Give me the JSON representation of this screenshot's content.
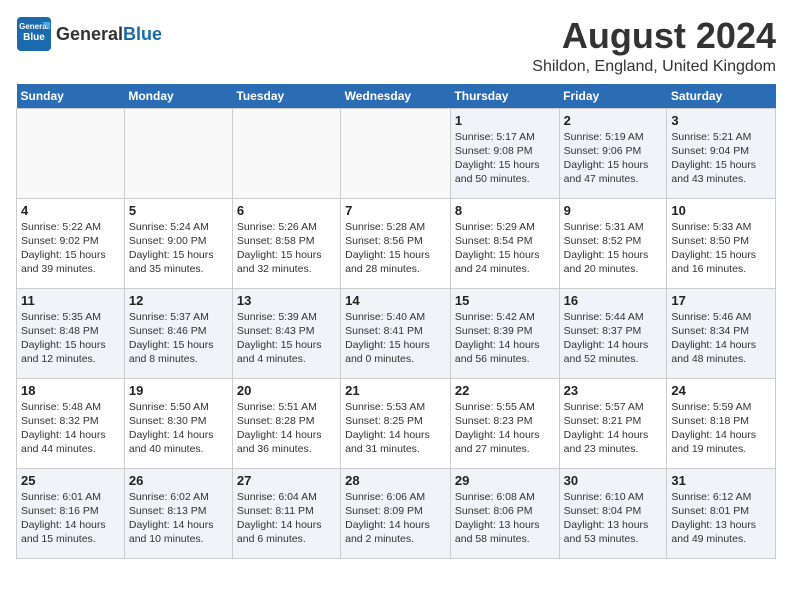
{
  "header": {
    "logo_general": "General",
    "logo_blue": "Blue",
    "month_year": "August 2024",
    "location": "Shildon, England, United Kingdom"
  },
  "weekdays": [
    "Sunday",
    "Monday",
    "Tuesday",
    "Wednesday",
    "Thursday",
    "Friday",
    "Saturday"
  ],
  "weeks": [
    [
      {
        "day": "",
        "info": ""
      },
      {
        "day": "",
        "info": ""
      },
      {
        "day": "",
        "info": ""
      },
      {
        "day": "",
        "info": ""
      },
      {
        "day": "1",
        "info": "Sunrise: 5:17 AM\nSunset: 9:08 PM\nDaylight: 15 hours\nand 50 minutes."
      },
      {
        "day": "2",
        "info": "Sunrise: 5:19 AM\nSunset: 9:06 PM\nDaylight: 15 hours\nand 47 minutes."
      },
      {
        "day": "3",
        "info": "Sunrise: 5:21 AM\nSunset: 9:04 PM\nDaylight: 15 hours\nand 43 minutes."
      }
    ],
    [
      {
        "day": "4",
        "info": "Sunrise: 5:22 AM\nSunset: 9:02 PM\nDaylight: 15 hours\nand 39 minutes."
      },
      {
        "day": "5",
        "info": "Sunrise: 5:24 AM\nSunset: 9:00 PM\nDaylight: 15 hours\nand 35 minutes."
      },
      {
        "day": "6",
        "info": "Sunrise: 5:26 AM\nSunset: 8:58 PM\nDaylight: 15 hours\nand 32 minutes."
      },
      {
        "day": "7",
        "info": "Sunrise: 5:28 AM\nSunset: 8:56 PM\nDaylight: 15 hours\nand 28 minutes."
      },
      {
        "day": "8",
        "info": "Sunrise: 5:29 AM\nSunset: 8:54 PM\nDaylight: 15 hours\nand 24 minutes."
      },
      {
        "day": "9",
        "info": "Sunrise: 5:31 AM\nSunset: 8:52 PM\nDaylight: 15 hours\nand 20 minutes."
      },
      {
        "day": "10",
        "info": "Sunrise: 5:33 AM\nSunset: 8:50 PM\nDaylight: 15 hours\nand 16 minutes."
      }
    ],
    [
      {
        "day": "11",
        "info": "Sunrise: 5:35 AM\nSunset: 8:48 PM\nDaylight: 15 hours\nand 12 minutes."
      },
      {
        "day": "12",
        "info": "Sunrise: 5:37 AM\nSunset: 8:46 PM\nDaylight: 15 hours\nand 8 minutes."
      },
      {
        "day": "13",
        "info": "Sunrise: 5:39 AM\nSunset: 8:43 PM\nDaylight: 15 hours\nand 4 minutes."
      },
      {
        "day": "14",
        "info": "Sunrise: 5:40 AM\nSunset: 8:41 PM\nDaylight: 15 hours\nand 0 minutes."
      },
      {
        "day": "15",
        "info": "Sunrise: 5:42 AM\nSunset: 8:39 PM\nDaylight: 14 hours\nand 56 minutes."
      },
      {
        "day": "16",
        "info": "Sunrise: 5:44 AM\nSunset: 8:37 PM\nDaylight: 14 hours\nand 52 minutes."
      },
      {
        "day": "17",
        "info": "Sunrise: 5:46 AM\nSunset: 8:34 PM\nDaylight: 14 hours\nand 48 minutes."
      }
    ],
    [
      {
        "day": "18",
        "info": "Sunrise: 5:48 AM\nSunset: 8:32 PM\nDaylight: 14 hours\nand 44 minutes."
      },
      {
        "day": "19",
        "info": "Sunrise: 5:50 AM\nSunset: 8:30 PM\nDaylight: 14 hours\nand 40 minutes."
      },
      {
        "day": "20",
        "info": "Sunrise: 5:51 AM\nSunset: 8:28 PM\nDaylight: 14 hours\nand 36 minutes."
      },
      {
        "day": "21",
        "info": "Sunrise: 5:53 AM\nSunset: 8:25 PM\nDaylight: 14 hours\nand 31 minutes."
      },
      {
        "day": "22",
        "info": "Sunrise: 5:55 AM\nSunset: 8:23 PM\nDaylight: 14 hours\nand 27 minutes."
      },
      {
        "day": "23",
        "info": "Sunrise: 5:57 AM\nSunset: 8:21 PM\nDaylight: 14 hours\nand 23 minutes."
      },
      {
        "day": "24",
        "info": "Sunrise: 5:59 AM\nSunset: 8:18 PM\nDaylight: 14 hours\nand 19 minutes."
      }
    ],
    [
      {
        "day": "25",
        "info": "Sunrise: 6:01 AM\nSunset: 8:16 PM\nDaylight: 14 hours\nand 15 minutes."
      },
      {
        "day": "26",
        "info": "Sunrise: 6:02 AM\nSunset: 8:13 PM\nDaylight: 14 hours\nand 10 minutes."
      },
      {
        "day": "27",
        "info": "Sunrise: 6:04 AM\nSunset: 8:11 PM\nDaylight: 14 hours\nand 6 minutes."
      },
      {
        "day": "28",
        "info": "Sunrise: 6:06 AM\nSunset: 8:09 PM\nDaylight: 14 hours\nand 2 minutes."
      },
      {
        "day": "29",
        "info": "Sunrise: 6:08 AM\nSunset: 8:06 PM\nDaylight: 13 hours\nand 58 minutes."
      },
      {
        "day": "30",
        "info": "Sunrise: 6:10 AM\nSunset: 8:04 PM\nDaylight: 13 hours\nand 53 minutes."
      },
      {
        "day": "31",
        "info": "Sunrise: 6:12 AM\nSunset: 8:01 PM\nDaylight: 13 hours\nand 49 minutes."
      }
    ]
  ]
}
